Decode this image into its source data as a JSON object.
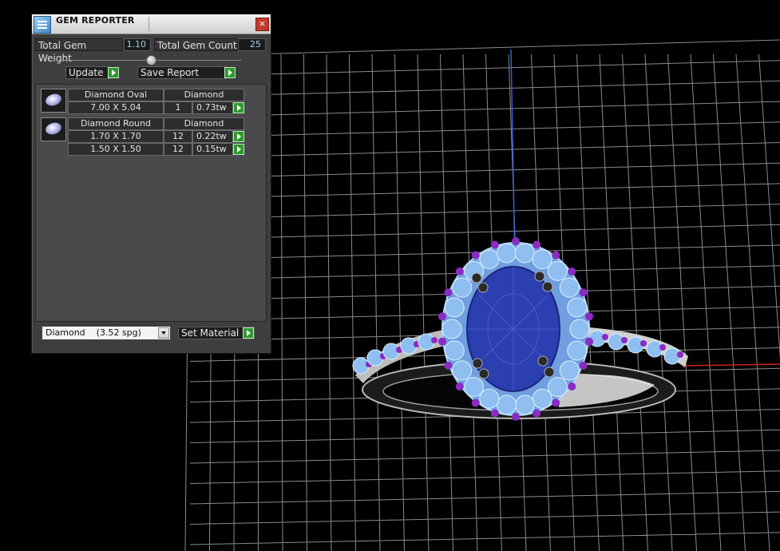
{
  "panel": {
    "title": "GEM REPORTER",
    "close_label": "×",
    "stats": {
      "weight_label": "Total Gem Weight",
      "weight_value": "1.10",
      "count_label": "Total Gem Count",
      "count_value": "25"
    },
    "actions": {
      "update_label": "Update",
      "save_label": "Save Report"
    },
    "groups": [
      {
        "cut": "Diamond Oval",
        "material": "Diamond",
        "rows": [
          {
            "size": "7.00 X 5.04",
            "count": "1",
            "weight": "0.73tw"
          }
        ]
      },
      {
        "cut": "Diamond Round",
        "material": "Diamond",
        "rows": [
          {
            "size": "1.70 X 1.70",
            "count": "12",
            "weight": "0.22tw"
          },
          {
            "size": "1.50 X 1.50",
            "count": "12",
            "weight": "0.15tw"
          }
        ]
      }
    ],
    "material_select": {
      "value": "Diamond    (3.52 spg)"
    },
    "set_material_label": "Set Material"
  },
  "viewport": {
    "background": "#000000",
    "grid_color": "#b9b9b9",
    "axis_y_color": "#3b5dd8",
    "axis_x_color": "#cc2222",
    "center_stone_color": "#2c3fb0",
    "halo_stone_color": "#8fbff0",
    "accent_stone_color": "#8a2bc2",
    "prong_color": "#2a2a2a"
  }
}
